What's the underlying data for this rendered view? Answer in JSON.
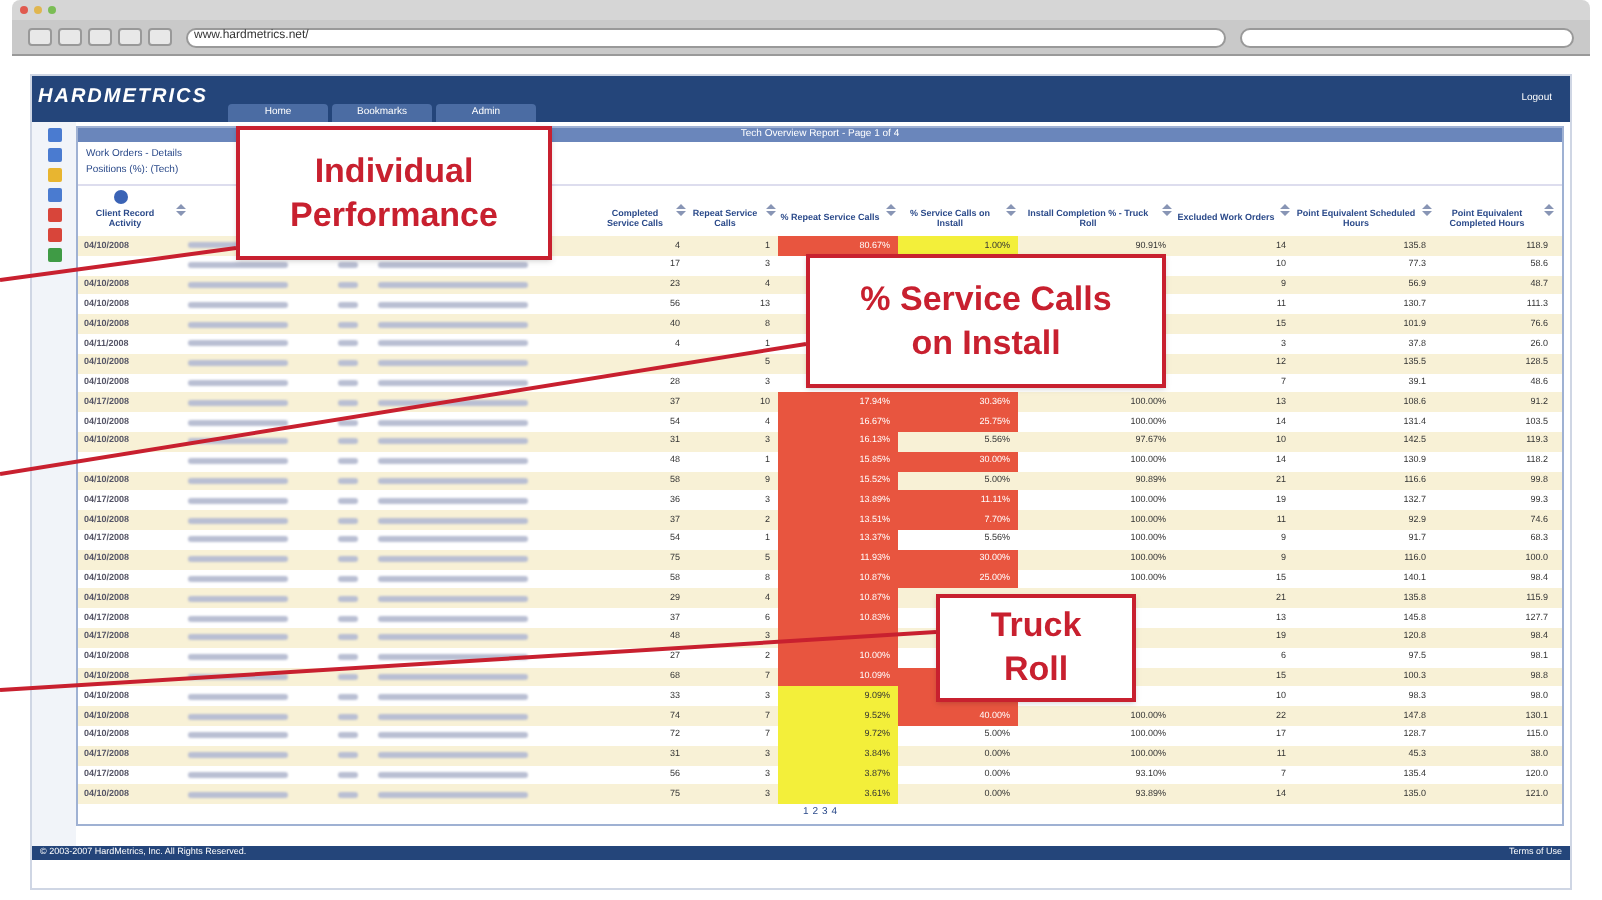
{
  "browser": {
    "url": "www.hardmetrics.net/"
  },
  "header": {
    "logo": "HARDMETRICS",
    "tabs": [
      {
        "label": "Home",
        "selected": false
      },
      {
        "label": "Bookmarks",
        "selected": false
      },
      {
        "label": "Admin",
        "selected": false
      }
    ],
    "logout": "Logout"
  },
  "panel": {
    "title": "Tech Overview Report - Page 1 of 4",
    "heading": "Work Orders - Details",
    "subheading": "Positions (%): (Tech)"
  },
  "table": {
    "columns": [
      "Client Record Activity",
      "Completed Service Calls",
      "Repeat Service Calls",
      "% Repeat Service Calls",
      "% Service Calls on Install",
      "Install Completion % - Truck Roll",
      "Excluded Work Orders",
      "Point Equivalent Scheduled Hours",
      "Point Equivalent Completed Hours"
    ],
    "rows": [
      {
        "date": "04/10/2008",
        "completed": "4",
        "repeat": "1",
        "repeat_pct": {
          "text": "80.67%",
          "color": "#e8553f"
        },
        "install_pct": {
          "text": "1.00%",
          "color": "#f3ef3a"
        },
        "truck_roll": "90.91%",
        "excluded": "14",
        "sched": "135.8",
        "compl": "118.9"
      },
      {
        "completed": "17",
        "repeat": "3",
        "excluded": "10",
        "sched": "77.3",
        "compl": "58.6"
      },
      {
        "date": "04/10/2008",
        "completed": "23",
        "repeat": "4",
        "excluded": "9",
        "sched": "56.9",
        "compl": "48.7"
      },
      {
        "date": "04/10/2008",
        "completed": "56",
        "repeat": "13",
        "excluded": "11",
        "sched": "130.7",
        "compl": "111.3"
      },
      {
        "date": "04/10/2008",
        "completed": "40",
        "repeat": "8",
        "excluded": "15",
        "sched": "101.9",
        "compl": "76.6"
      },
      {
        "date": "04/11/2008",
        "completed": "4",
        "repeat": "1",
        "excluded": "3",
        "sched": "37.8",
        "compl": "26.0"
      },
      {
        "date": "04/10/2008",
        "repeat": "5",
        "excluded": "12",
        "sched": "135.5",
        "compl": "128.5"
      },
      {
        "date": "04/10/2008",
        "completed": "28",
        "repeat": "3",
        "excluded": "7",
        "sched": "39.1",
        "compl": "48.6"
      },
      {
        "date": "04/17/2008",
        "completed": "37",
        "repeat": "10",
        "repeat_pct": {
          "text": "17.94%",
          "color": "#e8553f"
        },
        "install_pct": {
          "text": "30.36%",
          "color": "#e8553f"
        },
        "truck_roll": "100.00%",
        "excluded": "13",
        "sched": "108.6",
        "compl": "91.2"
      },
      {
        "date": "04/10/2008",
        "completed": "54",
        "repeat": "4",
        "repeat_pct": {
          "text": "16.67%",
          "color": "#e8553f"
        },
        "install_pct": {
          "text": "25.75%",
          "color": "#e8553f"
        },
        "truck_roll": "100.00%",
        "excluded": "14",
        "sched": "131.4",
        "compl": "103.5"
      },
      {
        "date": "04/10/2008",
        "completed": "31",
        "repeat": "3",
        "repeat_pct": {
          "text": "16.13%",
          "color": "#e8553f"
        },
        "install_pct": {
          "text": "5.56%"
        },
        "truck_roll": "97.67%",
        "excluded": "10",
        "sched": "142.5",
        "compl": "119.3"
      },
      {
        "completed": "48",
        "repeat": "1",
        "repeat_pct": {
          "text": "15.85%",
          "color": "#e8553f"
        },
        "install_pct": {
          "text": "30.00%",
          "color": "#e8553f"
        },
        "truck_roll": "100.00%",
        "excluded": "14",
        "sched": "130.9",
        "compl": "118.2"
      },
      {
        "date": "04/10/2008",
        "completed": "58",
        "repeat": "9",
        "repeat_pct": {
          "text": "15.52%",
          "color": "#e8553f"
        },
        "install_pct": {
          "text": "5.00%"
        },
        "truck_roll": "90.89%",
        "excluded": "21",
        "sched": "116.6",
        "compl": "99.8"
      },
      {
        "date": "04/17/2008",
        "completed": "36",
        "repeat": "3",
        "repeat_pct": {
          "text": "13.89%",
          "color": "#e8553f"
        },
        "install_pct": {
          "text": "11.11%",
          "color": "#e8553f"
        },
        "truck_roll": "100.00%",
        "excluded": "19",
        "sched": "132.7",
        "compl": "99.3"
      },
      {
        "date": "04/10/2008",
        "completed": "37",
        "repeat": "2",
        "repeat_pct": {
          "text": "13.51%",
          "color": "#e8553f"
        },
        "install_pct": {
          "text": "7.70%",
          "color": "#e8553f"
        },
        "truck_roll": "100.00%",
        "excluded": "11",
        "sched": "92.9",
        "compl": "74.6"
      },
      {
        "date": "04/17/2008",
        "completed": "54",
        "repeat": "1",
        "repeat_pct": {
          "text": "13.37%",
          "color": "#e8553f"
        },
        "install_pct": {
          "text": "5.56%"
        },
        "truck_roll": "100.00%",
        "excluded": "9",
        "sched": "91.7",
        "compl": "68.3"
      },
      {
        "date": "04/10/2008",
        "completed": "75",
        "repeat": "5",
        "repeat_pct": {
          "text": "11.93%",
          "color": "#e8553f"
        },
        "install_pct": {
          "text": "30.00%",
          "color": "#e8553f"
        },
        "truck_roll": "100.00%",
        "excluded": "9",
        "sched": "116.0",
        "compl": "100.0"
      },
      {
        "date": "04/10/2008",
        "completed": "58",
        "repeat": "8",
        "repeat_pct": {
          "text": "10.87%",
          "color": "#e8553f"
        },
        "install_pct": {
          "text": "25.00%",
          "color": "#e8553f"
        },
        "truck_roll": "100.00%",
        "excluded": "15",
        "sched": "140.1",
        "compl": "98.4"
      },
      {
        "date": "04/10/2008",
        "completed": "29",
        "repeat": "4",
        "repeat_pct": {
          "text": "10.87%",
          "color": "#e8553f"
        },
        "excluded": "21",
        "sched": "135.8",
        "compl": "115.9"
      },
      {
        "date": "04/17/2008",
        "completed": "37",
        "repeat": "6",
        "repeat_pct": {
          "text": "10.83%",
          "color": "#e8553f"
        },
        "excluded": "13",
        "sched": "145.8",
        "compl": "127.7"
      },
      {
        "date": "04/17/2008",
        "completed": "48",
        "repeat": "3",
        "repeat_pct": {
          "color": "#e8553f"
        },
        "excluded": "19",
        "sched": "120.8",
        "compl": "98.4"
      },
      {
        "date": "04/10/2008",
        "completed": "27",
        "repeat": "2",
        "repeat_pct": {
          "text": "10.00%",
          "color": "#e8553f"
        },
        "excluded": "6",
        "sched": "97.5",
        "compl": "98.1"
      },
      {
        "date": "04/10/2008",
        "completed": "68",
        "repeat": "7",
        "repeat_pct": {
          "text": "10.09%",
          "color": "#e8553f"
        },
        "install_pct": {
          "color": "#e8553f"
        },
        "excluded": "15",
        "sched": "100.3",
        "compl": "98.8"
      },
      {
        "date": "04/10/2008",
        "completed": "33",
        "repeat": "3",
        "repeat_pct": {
          "text": "9.09%",
          "color": "#f3ef3a"
        },
        "install_pct": {
          "color": "#e8553f"
        },
        "excluded": "10",
        "sched": "98.3",
        "compl": "98.0"
      },
      {
        "date": "04/10/2008",
        "completed": "74",
        "repeat": "7",
        "repeat_pct": {
          "text": "9.52%",
          "color": "#f3ef3a"
        },
        "install_pct": {
          "text": "40.00%",
          "color": "#e8553f"
        },
        "truck_roll": "100.00%",
        "excluded": "22",
        "sched": "147.8",
        "compl": "130.1"
      },
      {
        "date": "04/10/2008",
        "completed": "72",
        "repeat": "7",
        "repeat_pct": {
          "text": "9.72%",
          "color": "#f3ef3a"
        },
        "install_pct": {
          "text": "5.00%"
        },
        "truck_roll": "100.00%",
        "excluded": "17",
        "sched": "128.7",
        "compl": "115.0"
      },
      {
        "date": "04/17/2008",
        "completed": "31",
        "repeat": "3",
        "repeat_pct": {
          "text": "3.84%",
          "color": "#f3ef3a"
        },
        "install_pct": {
          "text": "0.00%"
        },
        "truck_roll": "100.00%",
        "excluded": "11",
        "sched": "45.3",
        "compl": "38.0"
      },
      {
        "date": "04/17/2008",
        "completed": "56",
        "repeat": "3",
        "repeat_pct": {
          "text": "3.87%",
          "color": "#f3ef3a"
        },
        "install_pct": {
          "text": "0.00%"
        },
        "truck_roll": "93.10%",
        "excluded": "7",
        "sched": "135.4",
        "compl": "120.0"
      },
      {
        "date": "04/10/2008",
        "completed": "75",
        "repeat": "3",
        "repeat_pct": {
          "text": "3.61%",
          "color": "#f3ef3a"
        },
        "install_pct": {
          "text": "0.00%"
        },
        "truck_roll": "93.89%",
        "excluded": "14",
        "sched": "135.0",
        "compl": "121.0"
      }
    ]
  },
  "pager": [
    "1",
    "2",
    "3",
    "4"
  ],
  "footer": {
    "copyright": "© 2003-2007 HardMetrics, Inc. All Rights Reserved.",
    "terms": "Terms of Use"
  },
  "callouts": [
    "Individual Performance",
    "% Service Calls on Install",
    "Truck Roll"
  ]
}
